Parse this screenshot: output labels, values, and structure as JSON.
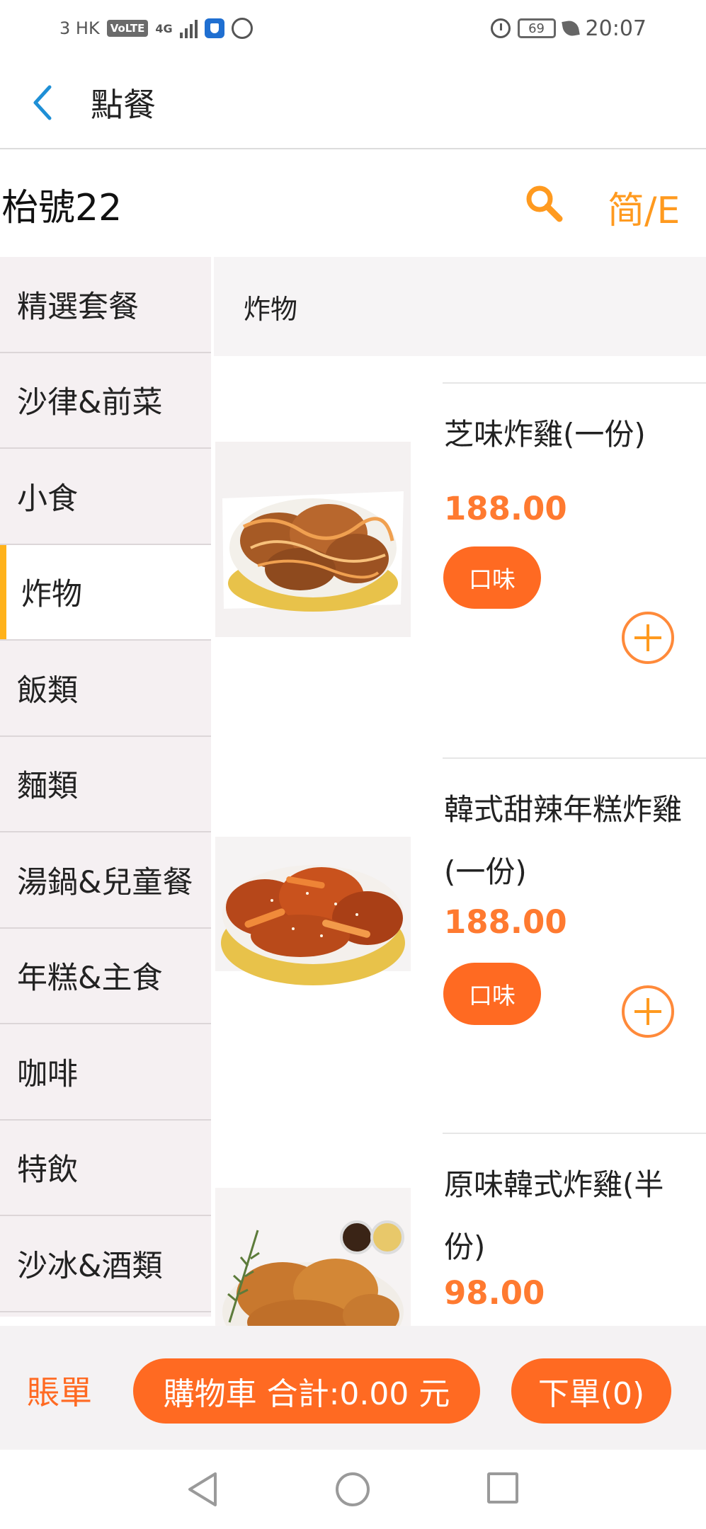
{
  "status_bar": {
    "carrier": "3 HK",
    "volte": "VoLTE",
    "network": "4G",
    "battery": "69",
    "time": "20:07"
  },
  "app_bar": {
    "title": "點餐"
  },
  "store": {
    "name": "枱號22",
    "language_toggle": "简/E"
  },
  "categories": [
    {
      "label": "精選套餐",
      "active": false
    },
    {
      "label": "沙律&前菜",
      "active": false
    },
    {
      "label": "小食",
      "active": false
    },
    {
      "label": "炸物",
      "active": true
    },
    {
      "label": "飯類",
      "active": false
    },
    {
      "label": "麵類",
      "active": false
    },
    {
      "label": "湯鍋&兒童餐",
      "active": false
    },
    {
      "label": "年糕&主食",
      "active": false
    },
    {
      "label": "咖啡",
      "active": false
    },
    {
      "label": "特飲",
      "active": false
    },
    {
      "label": "沙冰&酒類",
      "active": false
    }
  ],
  "section": {
    "title": "炸物"
  },
  "items": [
    {
      "name": "芝味炸雞(一份)",
      "price": "188.00",
      "flavor_label": "口味"
    },
    {
      "name": "韓式甜辣年糕炸雞(一份)",
      "price": "188.00",
      "flavor_label": "口味"
    },
    {
      "name": "原味韓式炸雞(半份)",
      "price": "98.00"
    }
  ],
  "bottom_bar": {
    "bill_label": "賬單",
    "cart_label": "購物車 合計:0.00 元",
    "order_label": "下單(0)"
  },
  "colors": {
    "accent": "#ff6a22",
    "price": "#ff7a30",
    "icon_orange": "#ff9a1f",
    "active_marker": "#ffb21a",
    "back_blue": "#1e8fd6"
  }
}
